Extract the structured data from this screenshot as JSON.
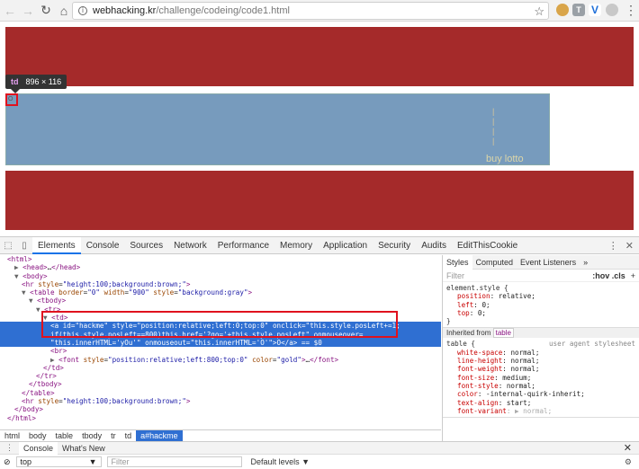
{
  "browser": {
    "url_host": "webhacking.kr",
    "url_path": "/challenge/codeing/code1.html"
  },
  "page": {
    "tooltip_tag": "td",
    "tooltip_size": "896 × 116",
    "link_text": "O",
    "buy_lotto": "buy lotto",
    "gold_marks": [
      "|",
      "|",
      "|",
      "|"
    ]
  },
  "devtools": {
    "tabs": [
      "Elements",
      "Console",
      "Sources",
      "Network",
      "Performance",
      "Memory",
      "Application",
      "Security",
      "Audits",
      "EditThisCookie"
    ],
    "active_tab": "Elements",
    "dom_lines": [
      {
        "indent": 0,
        "arrow": "",
        "html": "<span class='t'>&lt;html&gt;</span>"
      },
      {
        "indent": 1,
        "arrow": "▶",
        "html": "<span class='t'>&lt;head&gt;</span>…<span class='t'>&lt;/head&gt;</span>"
      },
      {
        "indent": 1,
        "arrow": "▼",
        "html": "<span class='t'>&lt;body&gt;</span>"
      },
      {
        "indent": 2,
        "arrow": "",
        "html": "<span class='t'>&lt;hr</span> <span class='a'>style</span>=<span class='v'>\"height:100;background:brown;\"</span><span class='t'>&gt;</span>"
      },
      {
        "indent": 2,
        "arrow": "▼",
        "html": "<span class='t'>&lt;table</span> <span class='a'>border</span>=<span class='v'>\"0\"</span> <span class='a'>width</span>=<span class='v'>\"900\"</span> <span class='a'>style</span>=<span class='v'>\"background:gray\"</span><span class='t'>&gt;</span>"
      },
      {
        "indent": 3,
        "arrow": "▼",
        "html": "<span class='t'>&lt;tbody&gt;</span>"
      },
      {
        "indent": 4,
        "arrow": "▼",
        "html": "<span class='t'>&lt;tr&gt;</span>"
      },
      {
        "indent": 5,
        "arrow": "▼",
        "html": "<span class='t'>&lt;td&gt;</span>"
      },
      {
        "indent": 6,
        "arrow": "",
        "selected": true,
        "html": "<span class='t'>&lt;a</span> <span class='a'>id</span>=<span class='v'>\"hackme\"</span> <span class='a'>style</span>=<span class='v'>\"position:relative;left:0;top:0\"</span> <span class='a'>onclick</span>=<span class='v'>\"this.style.posLeft+=1;</span>"
      },
      {
        "indent": 6,
        "arrow": "",
        "selected": true,
        "html": "<span class='v'>if(this.style.posLeft==800)this.href='?go='+this.style.posLeft\"</span> <span class='a'>onmouseover</span>="
      },
      {
        "indent": 6,
        "arrow": "",
        "selected": true,
        "html": "<span class='v'>\"this.innerHTML='yOu'\"</span> <span class='a'>onmouseout</span>=<span class='v'>\"this.innerHTML='O'\"</span>&gt;O<span class='t'>&lt;/a&gt;</span> == $0"
      },
      {
        "indent": 6,
        "arrow": "",
        "html": "<span class='t'>&lt;br&gt;</span>"
      },
      {
        "indent": 6,
        "arrow": "▶",
        "html": "<span class='t'>&lt;font</span> <span class='a'>style</span>=<span class='v'>\"position:relative;left:800;top:0\"</span> <span class='a'>color</span>=<span class='v'>\"gold\"</span><span class='t'>&gt;</span>…<span class='t'>&lt;/font&gt;</span>"
      },
      {
        "indent": 5,
        "arrow": "",
        "html": "<span class='t'>&lt;/td&gt;</span>"
      },
      {
        "indent": 4,
        "arrow": "",
        "html": "<span class='t'>&lt;/tr&gt;</span>"
      },
      {
        "indent": 3,
        "arrow": "",
        "html": "<span class='t'>&lt;/tbody&gt;</span>"
      },
      {
        "indent": 2,
        "arrow": "",
        "html": "<span class='t'>&lt;/table&gt;</span>"
      },
      {
        "indent": 2,
        "arrow": "",
        "html": "<span class='t'>&lt;hr</span> <span class='a'>style</span>=<span class='v'>\"height:100;background:brown;\"</span><span class='t'>&gt;</span>"
      },
      {
        "indent": 1,
        "arrow": "",
        "html": "<span class='t'>&lt;/body&gt;</span>"
      },
      {
        "indent": 0,
        "arrow": "",
        "html": "<span class='t'>&lt;/html&gt;</span>"
      }
    ],
    "breadcrumbs": [
      "html",
      "body",
      "table",
      "tbody",
      "tr",
      "td",
      "a#hackme"
    ],
    "styles_tabs": [
      "Styles",
      "Computed",
      "Event Listeners",
      "»"
    ],
    "filter_placeholder": "Filter",
    "hov_cls": ":hov  .cls",
    "element_style_selector": "element.style {",
    "element_style_props": [
      "position: relative;",
      "left: 0;",
      "top: 0;"
    ],
    "inherited_from": "Inherited from",
    "inherited_tag": "table",
    "table_selector": "table {",
    "ua_label": "user agent stylesheet",
    "table_props": [
      "white-space: normal;",
      "line-height: normal;",
      "font-weight: normal;",
      "font-size: medium;",
      "font-style: normal;",
      "color: -internal-quirk-inherit;",
      "text-align: start;",
      "font-variant: ▶ normal;"
    ],
    "drawer_tabs": [
      "Console",
      "What's New"
    ],
    "context": "top",
    "console_filter": "Filter",
    "default_levels": "Default levels ▼"
  }
}
